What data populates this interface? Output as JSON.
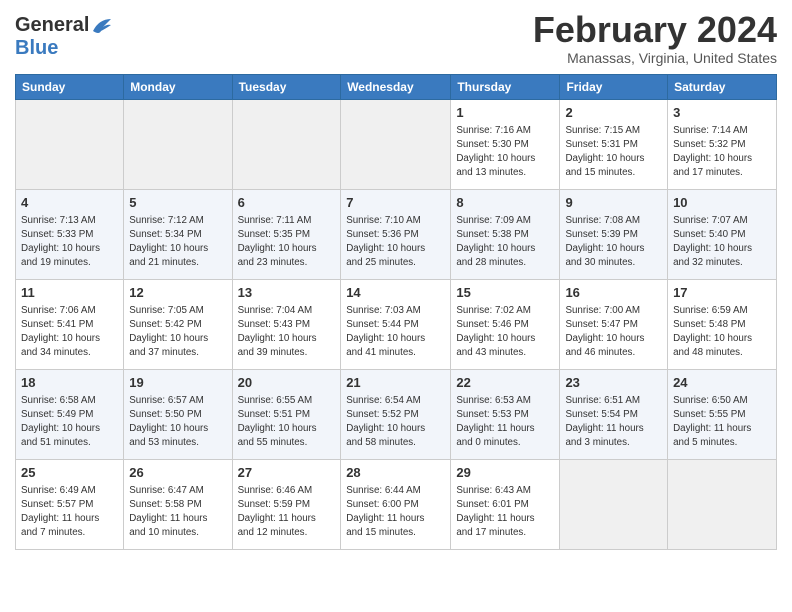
{
  "logo": {
    "general": "General",
    "blue": "Blue"
  },
  "header": {
    "month": "February 2024",
    "location": "Manassas, Virginia, United States"
  },
  "weekdays": [
    "Sunday",
    "Monday",
    "Tuesday",
    "Wednesday",
    "Thursday",
    "Friday",
    "Saturday"
  ],
  "weeks": [
    [
      {
        "day": "",
        "info": ""
      },
      {
        "day": "",
        "info": ""
      },
      {
        "day": "",
        "info": ""
      },
      {
        "day": "",
        "info": ""
      },
      {
        "day": "1",
        "info": "Sunrise: 7:16 AM\nSunset: 5:30 PM\nDaylight: 10 hours\nand 13 minutes."
      },
      {
        "day": "2",
        "info": "Sunrise: 7:15 AM\nSunset: 5:31 PM\nDaylight: 10 hours\nand 15 minutes."
      },
      {
        "day": "3",
        "info": "Sunrise: 7:14 AM\nSunset: 5:32 PM\nDaylight: 10 hours\nand 17 minutes."
      }
    ],
    [
      {
        "day": "4",
        "info": "Sunrise: 7:13 AM\nSunset: 5:33 PM\nDaylight: 10 hours\nand 19 minutes."
      },
      {
        "day": "5",
        "info": "Sunrise: 7:12 AM\nSunset: 5:34 PM\nDaylight: 10 hours\nand 21 minutes."
      },
      {
        "day": "6",
        "info": "Sunrise: 7:11 AM\nSunset: 5:35 PM\nDaylight: 10 hours\nand 23 minutes."
      },
      {
        "day": "7",
        "info": "Sunrise: 7:10 AM\nSunset: 5:36 PM\nDaylight: 10 hours\nand 25 minutes."
      },
      {
        "day": "8",
        "info": "Sunrise: 7:09 AM\nSunset: 5:38 PM\nDaylight: 10 hours\nand 28 minutes."
      },
      {
        "day": "9",
        "info": "Sunrise: 7:08 AM\nSunset: 5:39 PM\nDaylight: 10 hours\nand 30 minutes."
      },
      {
        "day": "10",
        "info": "Sunrise: 7:07 AM\nSunset: 5:40 PM\nDaylight: 10 hours\nand 32 minutes."
      }
    ],
    [
      {
        "day": "11",
        "info": "Sunrise: 7:06 AM\nSunset: 5:41 PM\nDaylight: 10 hours\nand 34 minutes."
      },
      {
        "day": "12",
        "info": "Sunrise: 7:05 AM\nSunset: 5:42 PM\nDaylight: 10 hours\nand 37 minutes."
      },
      {
        "day": "13",
        "info": "Sunrise: 7:04 AM\nSunset: 5:43 PM\nDaylight: 10 hours\nand 39 minutes."
      },
      {
        "day": "14",
        "info": "Sunrise: 7:03 AM\nSunset: 5:44 PM\nDaylight: 10 hours\nand 41 minutes."
      },
      {
        "day": "15",
        "info": "Sunrise: 7:02 AM\nSunset: 5:46 PM\nDaylight: 10 hours\nand 43 minutes."
      },
      {
        "day": "16",
        "info": "Sunrise: 7:00 AM\nSunset: 5:47 PM\nDaylight: 10 hours\nand 46 minutes."
      },
      {
        "day": "17",
        "info": "Sunrise: 6:59 AM\nSunset: 5:48 PM\nDaylight: 10 hours\nand 48 minutes."
      }
    ],
    [
      {
        "day": "18",
        "info": "Sunrise: 6:58 AM\nSunset: 5:49 PM\nDaylight: 10 hours\nand 51 minutes."
      },
      {
        "day": "19",
        "info": "Sunrise: 6:57 AM\nSunset: 5:50 PM\nDaylight: 10 hours\nand 53 minutes."
      },
      {
        "day": "20",
        "info": "Sunrise: 6:55 AM\nSunset: 5:51 PM\nDaylight: 10 hours\nand 55 minutes."
      },
      {
        "day": "21",
        "info": "Sunrise: 6:54 AM\nSunset: 5:52 PM\nDaylight: 10 hours\nand 58 minutes."
      },
      {
        "day": "22",
        "info": "Sunrise: 6:53 AM\nSunset: 5:53 PM\nDaylight: 11 hours\nand 0 minutes."
      },
      {
        "day": "23",
        "info": "Sunrise: 6:51 AM\nSunset: 5:54 PM\nDaylight: 11 hours\nand 3 minutes."
      },
      {
        "day": "24",
        "info": "Sunrise: 6:50 AM\nSunset: 5:55 PM\nDaylight: 11 hours\nand 5 minutes."
      }
    ],
    [
      {
        "day": "25",
        "info": "Sunrise: 6:49 AM\nSunset: 5:57 PM\nDaylight: 11 hours\nand 7 minutes."
      },
      {
        "day": "26",
        "info": "Sunrise: 6:47 AM\nSunset: 5:58 PM\nDaylight: 11 hours\nand 10 minutes."
      },
      {
        "day": "27",
        "info": "Sunrise: 6:46 AM\nSunset: 5:59 PM\nDaylight: 11 hours\nand 12 minutes."
      },
      {
        "day": "28",
        "info": "Sunrise: 6:44 AM\nSunset: 6:00 PM\nDaylight: 11 hours\nand 15 minutes."
      },
      {
        "day": "29",
        "info": "Sunrise: 6:43 AM\nSunset: 6:01 PM\nDaylight: 11 hours\nand 17 minutes."
      },
      {
        "day": "",
        "info": ""
      },
      {
        "day": "",
        "info": ""
      }
    ]
  ]
}
